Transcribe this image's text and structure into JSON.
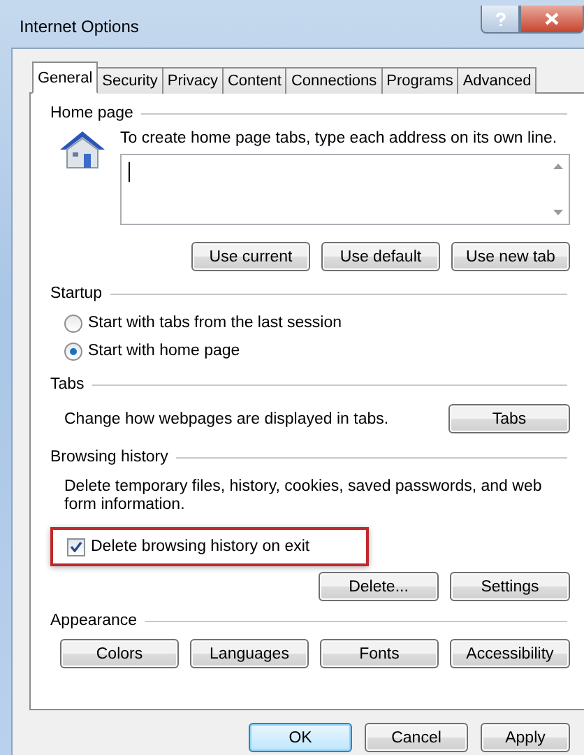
{
  "window": {
    "title": "Internet Options"
  },
  "tabs": [
    {
      "label": "General",
      "selected": true
    },
    {
      "label": "Security",
      "selected": false
    },
    {
      "label": "Privacy",
      "selected": false
    },
    {
      "label": "Content",
      "selected": false
    },
    {
      "label": "Connections",
      "selected": false
    },
    {
      "label": "Programs",
      "selected": false
    },
    {
      "label": "Advanced",
      "selected": false
    }
  ],
  "home_page": {
    "heading": "Home page",
    "instruction": "To create home page tabs, type each address on its own line.",
    "buttons": [
      "Use current",
      "Use default",
      "Use new tab"
    ]
  },
  "startup": {
    "heading": "Startup",
    "options": [
      {
        "label": "Start with tabs from the last session",
        "selected": false
      },
      {
        "label": "Start with home page",
        "selected": true
      }
    ]
  },
  "tabs_section": {
    "heading": "Tabs",
    "description": "Change how webpages are displayed in tabs.",
    "button": "Tabs"
  },
  "browsing_history": {
    "heading": "Browsing history",
    "description": "Delete temporary files, history, cookies, saved passwords, and web form information.",
    "delete_on_exit": {
      "label": "Delete browsing history on exit",
      "checked": true,
      "highlighted": true
    },
    "buttons": [
      "Delete...",
      "Settings"
    ]
  },
  "appearance": {
    "heading": "Appearance",
    "buttons": [
      "Colors",
      "Languages",
      "Fonts",
      "Accessibility"
    ]
  },
  "dialog_buttons": [
    {
      "label": "OK",
      "default": true
    },
    {
      "label": "Cancel",
      "default": false
    },
    {
      "label": "Apply",
      "default": false
    }
  ]
}
